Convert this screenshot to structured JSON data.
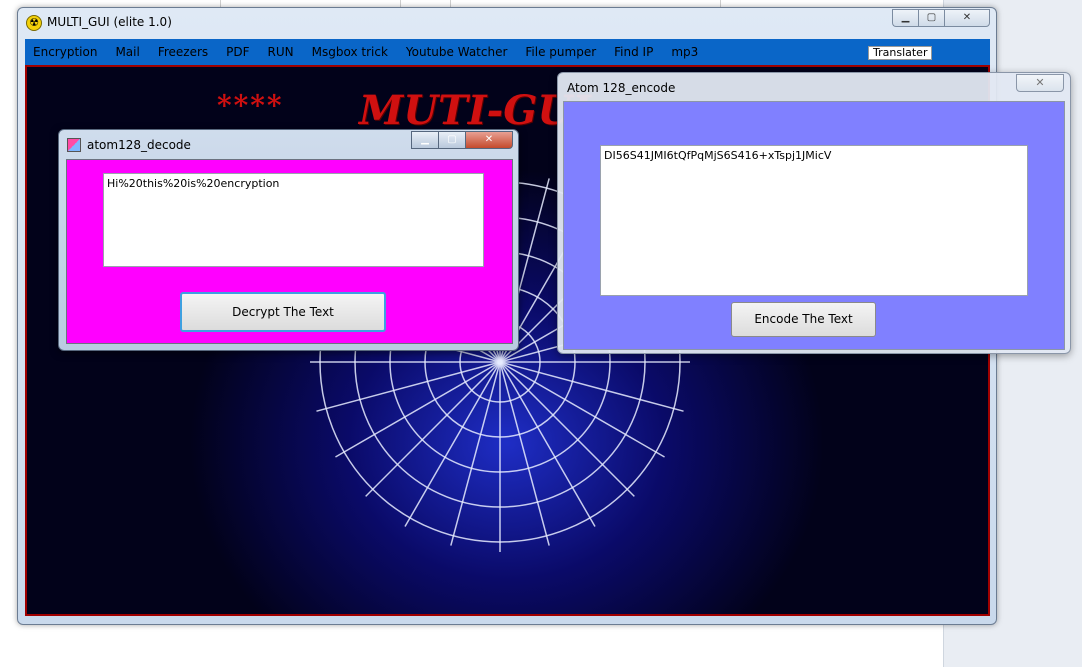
{
  "main_window": {
    "title": "MULTI_GUI (elite 1.0)",
    "caption": {
      "minimize": "▁",
      "maximize": "▢",
      "close": "✕"
    }
  },
  "menu": {
    "items": [
      "Encryption",
      "Mail",
      "Freezers",
      "PDF",
      "RUN",
      "Msgbox trick",
      "Youtube Watcher",
      "File pumper",
      "Find IP",
      "mp3"
    ],
    "translator": "Translater"
  },
  "banner": {
    "stars": "****",
    "text": "MUTI-GUI"
  },
  "decode_window": {
    "title": "atom128_decode",
    "caption": {
      "minimize": "▁",
      "maximize": "▢",
      "close": "✕"
    },
    "text_value": "Hi%20this%20is%20encryption",
    "button_label": "Decrypt The Text",
    "background_color": "#ff00ff"
  },
  "encode_window": {
    "title": "Atom 128_encode",
    "close": "✕",
    "text_value": "DI56S41JMI6tQfPqMjS6S416+xTspj1JMicV",
    "button_label": "Encode The Text",
    "background_color": "#8080ff"
  },
  "colors": {
    "menubar": "#0a66c8",
    "banner_red": "#d01010",
    "client_border": "#a00000"
  }
}
